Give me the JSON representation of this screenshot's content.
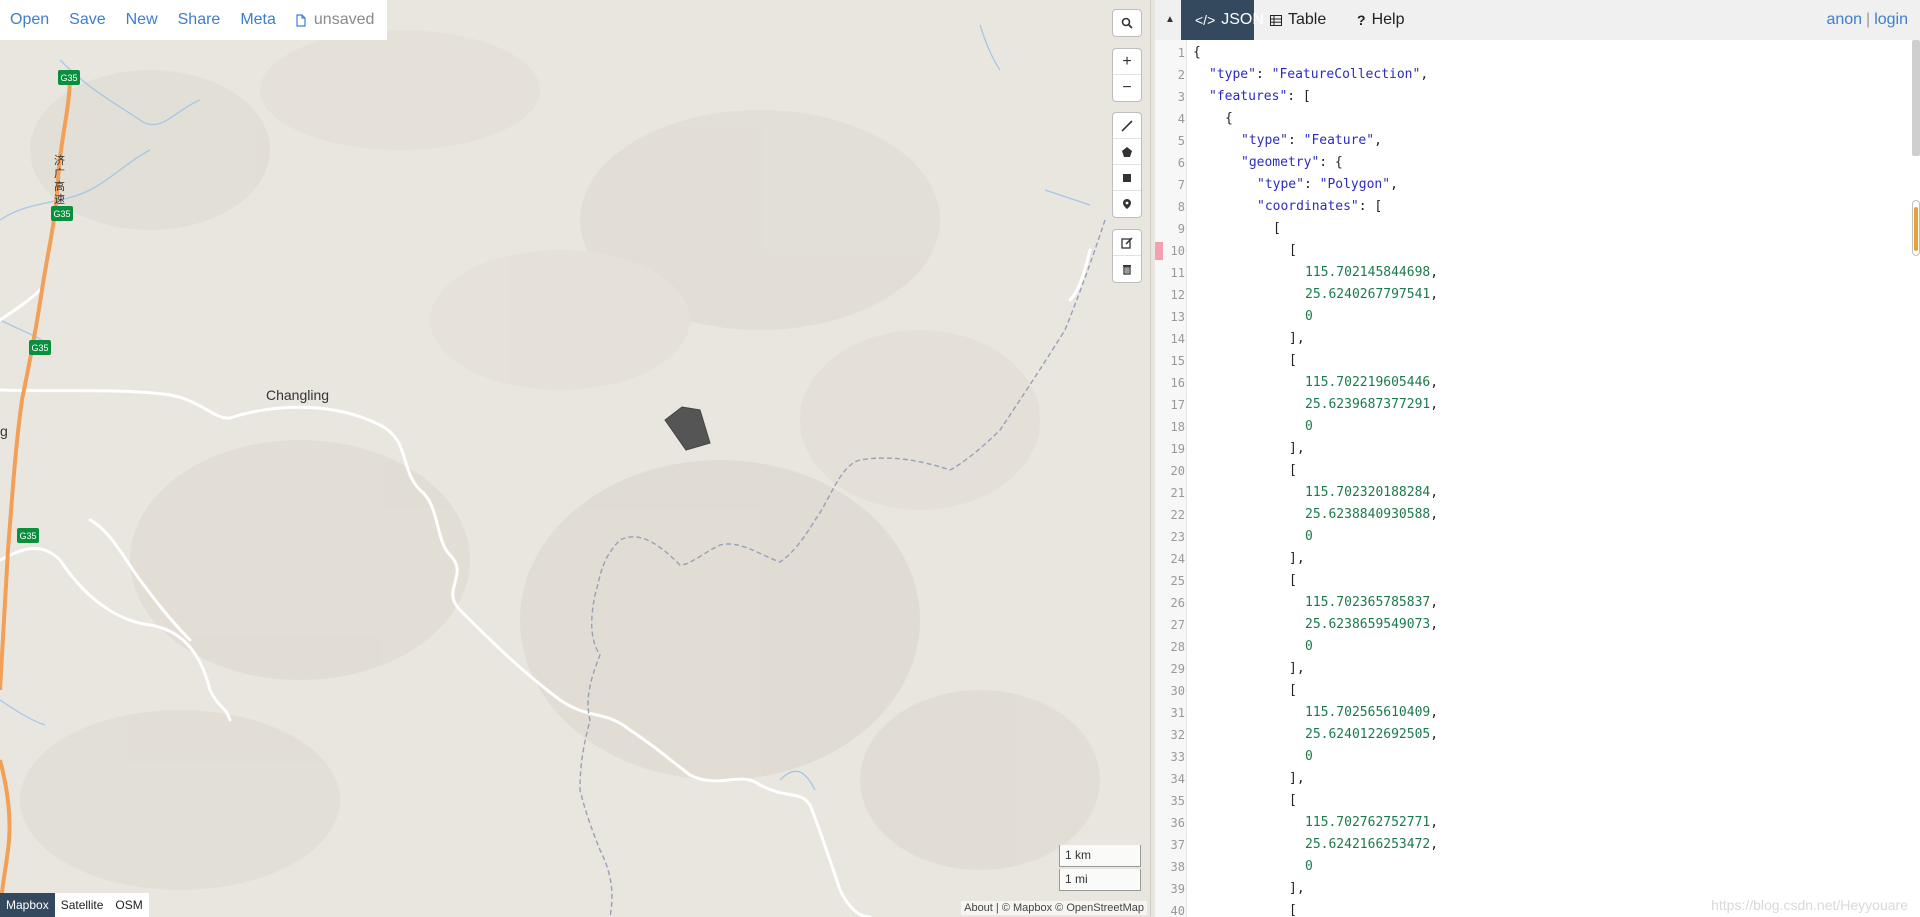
{
  "app": {
    "menu": [
      {
        "key": "open",
        "label": "Open"
      },
      {
        "key": "save",
        "label": "Save"
      },
      {
        "key": "new",
        "label": "New"
      },
      {
        "key": "share",
        "label": "Share"
      },
      {
        "key": "meta",
        "label": "Meta"
      }
    ],
    "status": {
      "label": "unsaved",
      "icon": "file-icon"
    }
  },
  "map": {
    "labels": {
      "changling": "Changling",
      "partial_left": "g",
      "road_vertical": "济\n广\n高\n速"
    },
    "shields": [
      "G35",
      "G35",
      "G35",
      "G35"
    ],
    "controls": {
      "search": {
        "icon": "search-icon"
      },
      "zoom": [
        {
          "icon": "zoom-in-icon",
          "glyph": "+"
        },
        {
          "icon": "zoom-out-icon",
          "glyph": "−"
        }
      ],
      "draw": [
        {
          "icon": "draw-line-icon"
        },
        {
          "icon": "draw-polygon-icon"
        },
        {
          "icon": "draw-rectangle-icon"
        },
        {
          "icon": "draw-marker-icon"
        }
      ],
      "edit": [
        {
          "icon": "edit-icon"
        },
        {
          "icon": "trash-icon"
        }
      ]
    },
    "scale": {
      "km": "1 km",
      "mi": "1 mi"
    },
    "layers": [
      {
        "label": "Mapbox",
        "active": true
      },
      {
        "label": "Satellite",
        "active": false
      },
      {
        "label": "OSM",
        "active": false
      }
    ],
    "attribution": {
      "text": "About | © Mapbox © OpenStreetMap"
    },
    "colors": {
      "background": "#e9e6e0",
      "highway": "#f2a057",
      "road": "#ffffff",
      "water": "#a7c6e6",
      "feature": "#555555",
      "shield": "#0a8f3d"
    }
  },
  "panel": {
    "tabs": [
      {
        "key": "json",
        "label": "JSON",
        "icon": "code-icon",
        "active": true
      },
      {
        "key": "table",
        "label": "Table",
        "icon": "table-icon",
        "active": false
      },
      {
        "key": "help",
        "label": "Help",
        "icon": "help-icon",
        "active": false
      }
    ],
    "user": {
      "anon": "anon",
      "separator": "|",
      "login": "login"
    },
    "collapse_glyph": "▲"
  },
  "editor": {
    "lines": [
      {
        "n": 1,
        "indent": 0,
        "text": "{"
      },
      {
        "n": 2,
        "indent": 1,
        "key": "type",
        "value": "FeatureCollection",
        "suffix": ","
      },
      {
        "n": 3,
        "indent": 1,
        "key": "features",
        "suffix": ": ["
      },
      {
        "n": 4,
        "indent": 2,
        "text": "{"
      },
      {
        "n": 5,
        "indent": 3,
        "key": "type",
        "value": "Feature",
        "suffix": ","
      },
      {
        "n": 6,
        "indent": 3,
        "key": "geometry",
        "suffix": ": {"
      },
      {
        "n": 7,
        "indent": 4,
        "key": "type",
        "value": "Polygon",
        "suffix": ","
      },
      {
        "n": 8,
        "indent": 4,
        "key": "coordinates",
        "suffix": ": ["
      },
      {
        "n": 9,
        "indent": 5,
        "text": "["
      },
      {
        "n": 10,
        "indent": 6,
        "text": "["
      },
      {
        "n": 11,
        "indent": 7,
        "num": "115.702145844698",
        "suffix": ","
      },
      {
        "n": 12,
        "indent": 7,
        "num": "25.6240267797541",
        "suffix": ","
      },
      {
        "n": 13,
        "indent": 7,
        "num": "0"
      },
      {
        "n": 14,
        "indent": 6,
        "text": "],"
      },
      {
        "n": 15,
        "indent": 6,
        "text": "["
      },
      {
        "n": 16,
        "indent": 7,
        "num": "115.702219605446",
        "suffix": ","
      },
      {
        "n": 17,
        "indent": 7,
        "num": "25.6239687377291",
        "suffix": ","
      },
      {
        "n": 18,
        "indent": 7,
        "num": "0"
      },
      {
        "n": 19,
        "indent": 6,
        "text": "],"
      },
      {
        "n": 20,
        "indent": 6,
        "text": "["
      },
      {
        "n": 21,
        "indent": 7,
        "num": "115.702320188284",
        "suffix": ","
      },
      {
        "n": 22,
        "indent": 7,
        "num": "25.6238840930588",
        "suffix": ","
      },
      {
        "n": 23,
        "indent": 7,
        "num": "0"
      },
      {
        "n": 24,
        "indent": 6,
        "text": "],"
      },
      {
        "n": 25,
        "indent": 6,
        "text": "["
      },
      {
        "n": 26,
        "indent": 7,
        "num": "115.702365785837",
        "suffix": ","
      },
      {
        "n": 27,
        "indent": 7,
        "num": "25.6238659549073",
        "suffix": ","
      },
      {
        "n": 28,
        "indent": 7,
        "num": "0"
      },
      {
        "n": 29,
        "indent": 6,
        "text": "],"
      },
      {
        "n": 30,
        "indent": 6,
        "text": "["
      },
      {
        "n": 31,
        "indent": 7,
        "num": "115.702565610409",
        "suffix": ","
      },
      {
        "n": 32,
        "indent": 7,
        "num": "25.6240122692505",
        "suffix": ","
      },
      {
        "n": 33,
        "indent": 7,
        "num": "0"
      },
      {
        "n": 34,
        "indent": 6,
        "text": "],"
      },
      {
        "n": 35,
        "indent": 6,
        "text": "["
      },
      {
        "n": 36,
        "indent": 7,
        "num": "115.702762752771",
        "suffix": ","
      },
      {
        "n": 37,
        "indent": 7,
        "num": "25.6242166253472",
        "suffix": ","
      },
      {
        "n": 38,
        "indent": 7,
        "num": "0"
      },
      {
        "n": 39,
        "indent": 6,
        "text": "],"
      },
      {
        "n": 40,
        "indent": 6,
        "text": "["
      }
    ]
  },
  "watermark": {
    "text": "https://blog.csdn.net/Heyyouare"
  }
}
